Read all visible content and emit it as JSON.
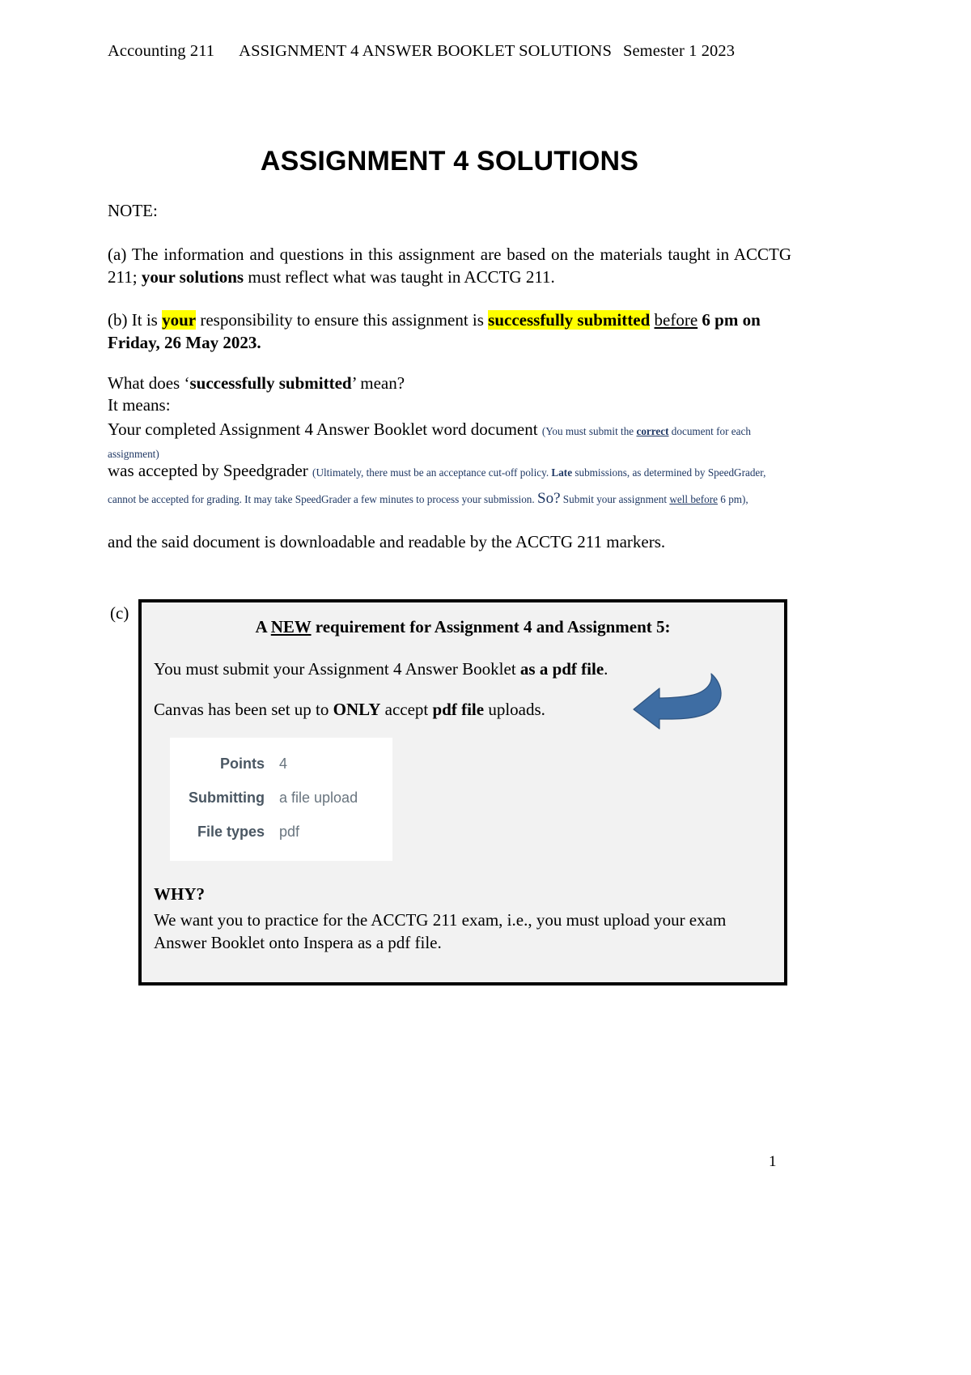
{
  "header": {
    "course": "Accounting 211",
    "doc_title": "ASSIGNMENT 4 ANSWER BOOKLET SOLUTIONS",
    "semester": "Semester 1 2023"
  },
  "title": "ASSIGNMENT 4 SOLUTIONS",
  "note_label": "NOTE:",
  "paragraphs": {
    "a": {
      "marker": "(a)",
      "text_1": "The information and questions in this assignment are based on the materials taught in ACCTG 211;",
      "bold_1": "your solutions",
      "text_2": "must reflect what was taught in ACCTG 211."
    },
    "b": {
      "marker": "(b)",
      "text_1": "It is",
      "hl_bold_1": "your",
      "text_2": "responsibility to ensure this assignment is",
      "hl_bold_2": "successfully submitted",
      "underline_1": "before",
      "bold_2": "6 pm on Friday, 26 May 2023."
    },
    "what_does": {
      "text_1": "What does ‘",
      "bold_1": "successfully submitted",
      "text_2": "’ mean?"
    },
    "it_means": "It means:",
    "your_completed": {
      "main": "Your completed Assignment 4 Answer Booklet word document",
      "note_1": "(You must submit the ",
      "note_bold_underline": "correct",
      "note_2": " document for each assignment)"
    },
    "speedgrader": {
      "main": "was accepted by Speedgrader",
      "note_1": "(Ultimately, there must be an acceptance cut-off policy. ",
      "note_bold_1": "Late",
      "note_2": " submissions, as determined by SpeedGrader, cannot be accepted for grading. It may take SpeedGrader a few minutes to process your submission. ",
      "note_big": "So?",
      "note_3": " Submit your assignment ",
      "note_underline": "well before",
      "note_4": " 6 pm),"
    },
    "and_said": "and the said document is downloadable and readable by the ACCTG 211 markers."
  },
  "note_box": {
    "marker": "(c)",
    "title_1": "A ",
    "title_underline": "NEW",
    "title_2": " requirement for Assignment 4 and Assignment 5:",
    "line1_text": "You must submit your Assignment 4 Answer Booklet",
    "line1_bold": "as a pdf file",
    "line1_end": ".",
    "line2_text_1": "Canvas has been set up to",
    "line2_bold_1": "ONLY",
    "line2_text_2": "accept",
    "line2_bold_2": "pdf file",
    "line2_text_3": "uploads.",
    "why_label": "WHY?",
    "why_text": "We want you to practice for the ACCTG 211 exam, i.e., you must upload your exam Answer Booklet onto Inspera as a pdf file.",
    "canvas_inset": {
      "rows": [
        {
          "label": "Points",
          "value": "4"
        },
        {
          "label": "Submitting",
          "value": "a file upload"
        },
        {
          "label": "File types",
          "value": "pdf"
        }
      ]
    }
  },
  "page_number": "1",
  "colors": {
    "highlight": "#ffff00",
    "small_note_blue": "#1f3864",
    "box_background": "#f2f2f2",
    "box_border": "#000000",
    "arrow_blue": "#3e6da3",
    "canvas_label": "#4a5763",
    "canvas_value": "#69757f"
  }
}
